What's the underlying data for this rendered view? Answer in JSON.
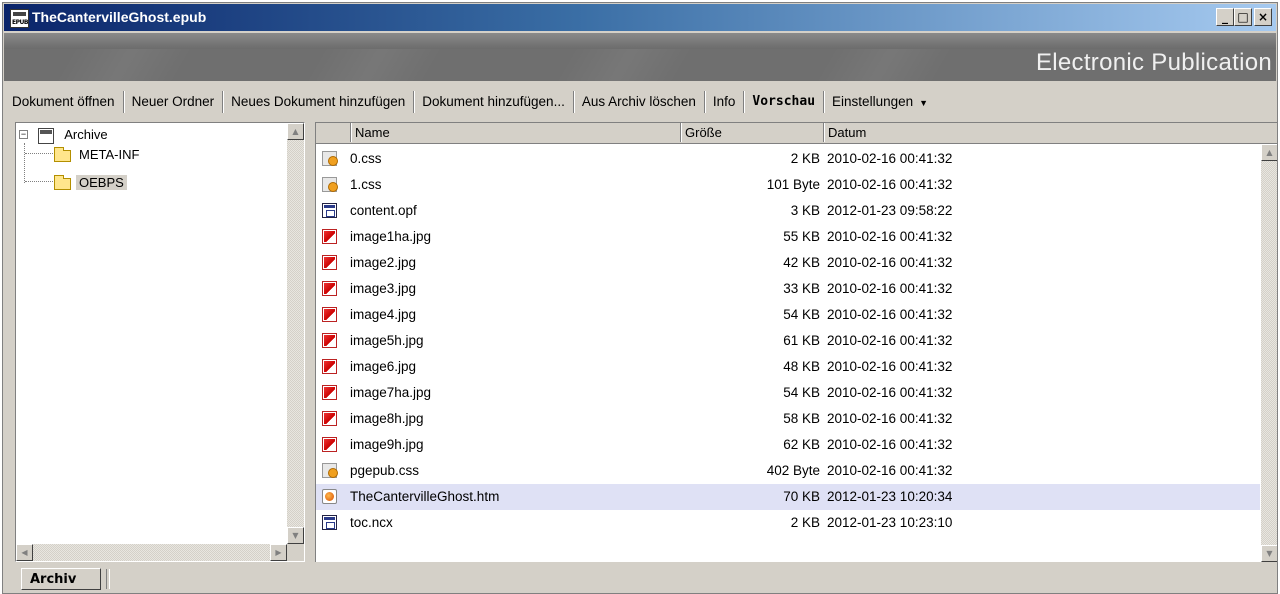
{
  "window": {
    "title": "TheCantervilleGhost.epub",
    "controls": {
      "minimize": "_",
      "maximize": "□",
      "close": "×"
    }
  },
  "banner": {
    "label": "Electronic Publication"
  },
  "toolbar": {
    "open": "Dokument öffnen",
    "new_folder": "Neuer Ordner",
    "add_new_document": "Neues Dokument hinzufügen",
    "add_document": "Dokument hinzufügen...",
    "delete_from_archive": "Aus Archiv löschen",
    "info": "Info",
    "preview": "Vorschau",
    "settings": "Einstellungen"
  },
  "tree": {
    "root": "Archive",
    "folders": [
      {
        "name": "META-INF",
        "selected": false
      },
      {
        "name": "OEBPS",
        "selected": true
      }
    ]
  },
  "list": {
    "columns": {
      "name": "Name",
      "size": "Größe",
      "date": "Datum"
    },
    "rows": [
      {
        "name": "0.css",
        "size": "2 KB",
        "date": "2010-02-16 00:41:32",
        "icon": "css-icon",
        "selected": false
      },
      {
        "name": "1.css",
        "size": "101 Byte",
        "date": "2010-02-16 00:41:32",
        "icon": "css-icon",
        "selected": false
      },
      {
        "name": "content.opf",
        "size": "3 KB",
        "date": "2012-01-23 09:58:22",
        "icon": "opf-icon",
        "selected": false
      },
      {
        "name": "image1ha.jpg",
        "size": "55 KB",
        "date": "2010-02-16 00:41:32",
        "icon": "jpg-icon",
        "selected": false
      },
      {
        "name": "image2.jpg",
        "size": "42 KB",
        "date": "2010-02-16 00:41:32",
        "icon": "jpg-icon",
        "selected": false
      },
      {
        "name": "image3.jpg",
        "size": "33 KB",
        "date": "2010-02-16 00:41:32",
        "icon": "jpg-icon",
        "selected": false
      },
      {
        "name": "image4.jpg",
        "size": "54 KB",
        "date": "2010-02-16 00:41:32",
        "icon": "jpg-icon",
        "selected": false
      },
      {
        "name": "image5h.jpg",
        "size": "61 KB",
        "date": "2010-02-16 00:41:32",
        "icon": "jpg-icon",
        "selected": false
      },
      {
        "name": "image6.jpg",
        "size": "48 KB",
        "date": "2010-02-16 00:41:32",
        "icon": "jpg-icon",
        "selected": false
      },
      {
        "name": "image7ha.jpg",
        "size": "54 KB",
        "date": "2010-02-16 00:41:32",
        "icon": "jpg-icon",
        "selected": false
      },
      {
        "name": "image8h.jpg",
        "size": "58 KB",
        "date": "2010-02-16 00:41:32",
        "icon": "jpg-icon",
        "selected": false
      },
      {
        "name": "image9h.jpg",
        "size": "62 KB",
        "date": "2010-02-16 00:41:32",
        "icon": "jpg-icon",
        "selected": false
      },
      {
        "name": "pgepub.css",
        "size": "402 Byte",
        "date": "2010-02-16 00:41:32",
        "icon": "css-icon",
        "selected": false
      },
      {
        "name": "TheCantervilleGhost.htm",
        "size": "70 KB",
        "date": "2012-01-23 10:20:34",
        "icon": "htm-icon",
        "selected": true
      },
      {
        "name": "toc.ncx",
        "size": "2 KB",
        "date": "2012-01-23 10:23:10",
        "icon": "ncx-icon",
        "selected": false
      }
    ]
  },
  "status": {
    "tab": "Archiv"
  },
  "colors": {
    "title_start": "#0a246a",
    "title_end": "#a6caf0",
    "selected_row": "#dfe1f5",
    "banner": "#6f6f6f"
  }
}
